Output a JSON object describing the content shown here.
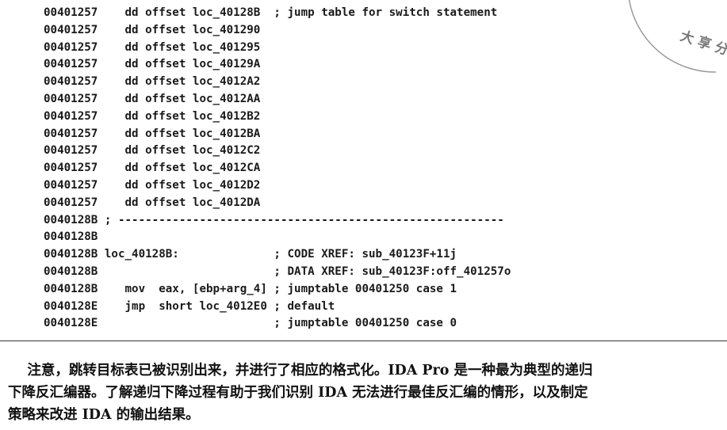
{
  "code_lines": [
    "00401257    dd offset loc_40128B  ; jump table for switch statement",
    "00401257    dd offset loc_401290",
    "00401257    dd offset loc_401295",
    "00401257    dd offset loc_40129A",
    "00401257    dd offset loc_4012A2",
    "00401257    dd offset loc_4012AA",
    "00401257    dd offset loc_4012B2",
    "00401257    dd offset loc_4012BA",
    "00401257    dd offset loc_4012C2",
    "00401257    dd offset loc_4012CA",
    "00401257    dd offset loc_4012D2",
    "00401257    dd offset loc_4012DA",
    "0040128B ; ---------------------------------------------------------",
    "0040128B",
    "0040128B loc_40128B:              ; CODE XREF: sub_40123F+11j",
    "0040128B                          ; DATA XREF: sub_40123F:off_401257o",
    "0040128B    mov  eax, [ebp+arg_4] ; jumptable 00401250 case 1",
    "0040128E    jmp  short loc_4012E0 ; default",
    "0040128E                          ; jumptable 00401250 case 0"
  ],
  "paragraph_lines": [
    "    注意，跳转目标表已被识别出来，并进行了相应的格式化。IDA Pro 是一种最为典型的递归",
    "下降反汇编器。了解递归下降过程有助于我们识别 IDA 无法进行最佳反汇编的情形，以及制定",
    "策略来改进 IDA 的输出结果。"
  ],
  "watermark_text": "大 享 分 源"
}
